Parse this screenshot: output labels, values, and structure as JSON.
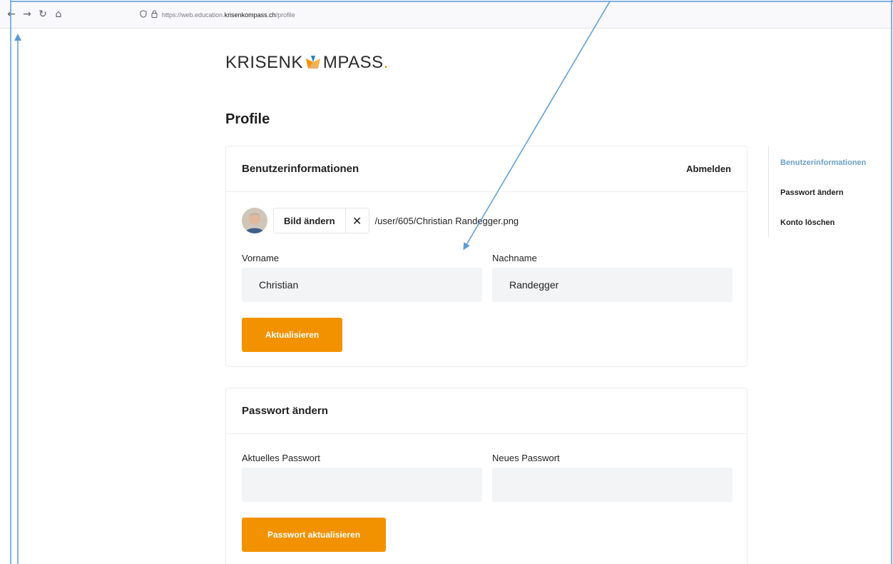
{
  "browser": {
    "back_icon": "←",
    "forward_icon": "→",
    "reload_icon": "↻",
    "home_icon": "⌂",
    "url_prefix": "https://web.education.",
    "url_host": "krisenkompass.ch",
    "url_path": "/profile"
  },
  "logo": {
    "text_left": "KRISENK",
    "text_right": "MPASS",
    "dot": "."
  },
  "page_title": "Profile",
  "user_info": {
    "title": "Benutzerinformationen",
    "logout_label": "Abmelden",
    "change_picture_label": "Bild ändern",
    "clear_icon": "✕",
    "filename": "/user/605/Christian Randegger.png",
    "first_name_label": "Vorname",
    "first_name_value": "Christian",
    "last_name_label": "Nachname",
    "last_name_value": "Randegger",
    "update_label": "Aktualisieren"
  },
  "password": {
    "title": "Passwort ändern",
    "current_label": "Aktuelles Passwort",
    "current_value": "",
    "new_label": "Neues Passwort",
    "new_value": "",
    "update_label": "Passwort aktualisieren"
  },
  "side_nav": {
    "items": [
      {
        "label": "Benutzerinformationen",
        "active": true
      },
      {
        "label": "Passwort ändern",
        "active": false
      },
      {
        "label": "Konto löschen",
        "active": false
      }
    ]
  },
  "colors": {
    "accent": "#f39200",
    "active_nav": "#6ea0c8",
    "annotation": "#5b9bd5"
  }
}
